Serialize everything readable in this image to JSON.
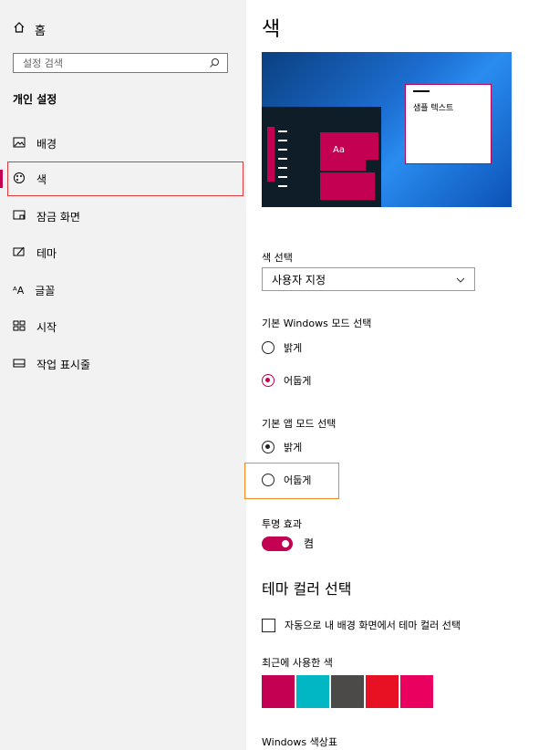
{
  "sidebar": {
    "home_label": "홈",
    "search_placeholder": "설정 검색",
    "section": "개인 설정",
    "items": [
      {
        "label": "배경",
        "icon": "image-icon"
      },
      {
        "label": "색",
        "icon": "palette-icon"
      },
      {
        "label": "잠금 화면",
        "icon": "lock-screen-icon"
      },
      {
        "label": "테마",
        "icon": "theme-icon"
      },
      {
        "label": "글꼴",
        "icon": "font-icon"
      },
      {
        "label": "시작",
        "icon": "start-icon"
      },
      {
        "label": "작업 표시줄",
        "icon": "taskbar-icon"
      }
    ]
  },
  "main": {
    "title": "색",
    "preview_sample_text": "샘플 텍스트",
    "preview_tile_text": "Aa",
    "color_select_label": "색 선택",
    "color_select_value": "사용자 지정",
    "windows_mode_label": "기본 Windows 모드 선택",
    "windows_mode_options": [
      "밝게",
      "어둡게"
    ],
    "windows_mode_selected": "어둡게",
    "app_mode_label": "기본 앱 모드 선택",
    "app_mode_options": [
      "밝게",
      "어둡게"
    ],
    "app_mode_selected": "밝게",
    "transparency_label": "투명 효과",
    "transparency_state": "켬",
    "accent_section_title": "테마 컬러 선택",
    "auto_accent_label": "자동으로 내 배경 화면에서 테마 컬러 선택",
    "recent_colors_label": "최근에 사용한 색",
    "recent_colors": [
      "#c30052",
      "#00b7c3",
      "#4c4a48",
      "#e81123",
      "#ea005e"
    ],
    "windows_colors_label": "Windows 색상표"
  },
  "colors": {
    "accent": "#c30052",
    "sidebar_bg": "#f2f2f2",
    "nav_highlight_border": "#e03b3b",
    "focus_highlight_border": "#f08a24"
  }
}
